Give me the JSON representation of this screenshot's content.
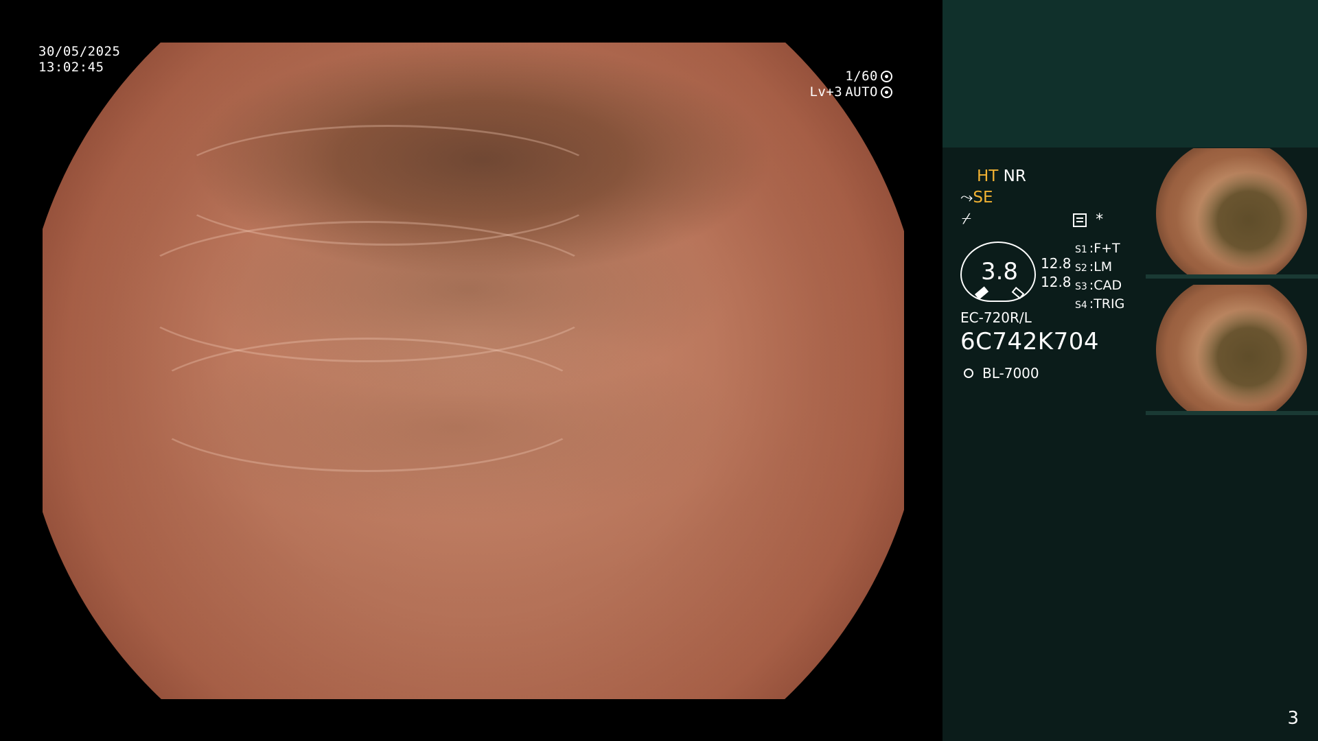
{
  "main": {
    "date": "30/05/2025",
    "time": "13:02:45",
    "shutter": "1/60",
    "level": "Lv+3",
    "iris_mode": "AUTO"
  },
  "panel": {
    "modes": {
      "ht": "HT",
      "nr": "NR",
      "se": "SE"
    },
    "zoom_value": "3.8",
    "zoom_side_1": "12.8",
    "zoom_side_2": "12.8",
    "switches": [
      {
        "key": "S1",
        "label": "F+T"
      },
      {
        "key": "S2",
        "label": "LM"
      },
      {
        "key": "S3",
        "label": "CAD"
      },
      {
        "key": "S4",
        "label": "TRIG"
      }
    ],
    "asterisk": "*",
    "scope_model": "EC-720R/L",
    "scope_serial": "6C742K704",
    "light_source": "BL-7000",
    "screen_number": "3"
  },
  "colors": {
    "accent_yellow": "#f2b233",
    "panel_bg": "#0b1c1a",
    "panel_top_bg": "#10302b"
  }
}
